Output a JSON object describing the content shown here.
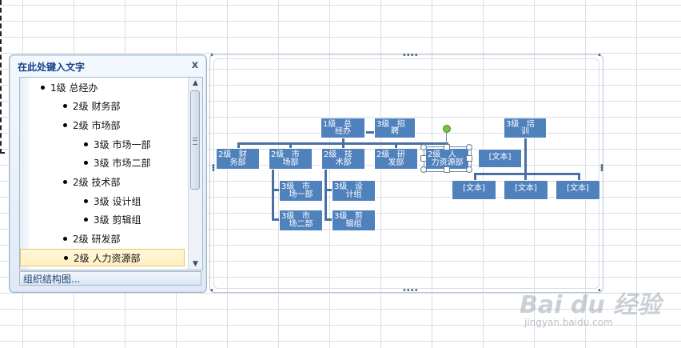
{
  "text_pane": {
    "title": "在此处键入文字",
    "close_label": "x",
    "items": [
      {
        "label": "1级 总经办",
        "level": 1
      },
      {
        "label": "2级 财务部",
        "level": 2
      },
      {
        "label": "2级 市场部",
        "level": 2
      },
      {
        "label": "3级 市场一部",
        "level": 3
      },
      {
        "label": "3级 市场二部",
        "level": 3
      },
      {
        "label": "2级 技术部",
        "level": 2
      },
      {
        "label": "3级 设计组",
        "level": 3
      },
      {
        "label": "3级 剪辑组",
        "level": 3
      },
      {
        "label": "2级 研发部",
        "level": 2
      },
      {
        "label": "2级 人力资源部",
        "level": 2,
        "selected": true
      }
    ],
    "footer": "组织结构图..."
  },
  "smartart": {
    "top_box": {
      "tag": "1级   总",
      "rest": "经办"
    },
    "assistant": {
      "tag": "3级   招",
      "rest": "聘"
    },
    "level2": [
      {
        "tag": "2级   财",
        "rest": "务部"
      },
      {
        "tag": "2级   市",
        "rest": "场部"
      },
      {
        "tag": "2级   技",
        "rest": "术部"
      },
      {
        "tag": "2级   研",
        "rest": "发部"
      },
      {
        "tag": "2级   人",
        "rest": "力资源部"
      }
    ],
    "market_children": [
      {
        "tag": "3级   市",
        "rest": "场一部"
      },
      {
        "tag": "3级   市",
        "rest": "场二部"
      }
    ],
    "tech_children": [
      {
        "tag": "3级   设",
        "rest": "计组"
      },
      {
        "tag": "3级   剪",
        "rest": "辑组"
      }
    ],
    "training": {
      "tag": "3级   培",
      "rest": "训"
    },
    "placeholder_assist": "[文本]",
    "placeholders": [
      "[文本]",
      "[文本]",
      "[文本]"
    ]
  },
  "watermark": {
    "main": "Bai du 经验",
    "sub": "jingyan.baidu.com"
  },
  "colors": {
    "box": "#4f81bd",
    "connector": "#4a6fa5",
    "pane_title": "#15428b",
    "rotate_handle": "#7bc043"
  }
}
